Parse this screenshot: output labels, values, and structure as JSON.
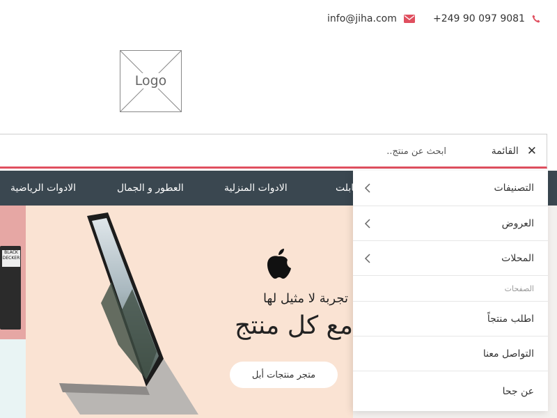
{
  "contact": {
    "email": "info@jiha.com",
    "phone": "+249 90 097 9081",
    "email_icon": "envelope-icon",
    "phone_icon": "phone-icon"
  },
  "logo": {
    "text": "Logo"
  },
  "search": {
    "menu_label": "القائمة",
    "close_icon": "close-icon",
    "placeholder": "ابحث عن منتج.."
  },
  "nav": {
    "categories": [
      "الادوات الرياضية",
      "العطور و الجمال",
      "الادوات المنزلية",
      "تابلت"
    ]
  },
  "hero": {
    "tagline": "تجربة لا مثيل لها",
    "headline": "مع كل منتج",
    "button": "متجر منتجات أبل",
    "drill_brand": "BLACK DECKER"
  },
  "menu": {
    "items": [
      {
        "label": "التصنيفات",
        "has_submenu": true
      },
      {
        "label": "العروض",
        "has_submenu": true
      },
      {
        "label": "المحلات",
        "has_submenu": true
      }
    ],
    "section_title": "الصفحات",
    "pages": [
      "اطلب منتجاً",
      "التواصل معنا",
      "عن جحا"
    ]
  },
  "colors": {
    "accent": "#e04f5f",
    "nav_bg": "#3a4750",
    "hero_bg": "#fae3d3"
  }
}
